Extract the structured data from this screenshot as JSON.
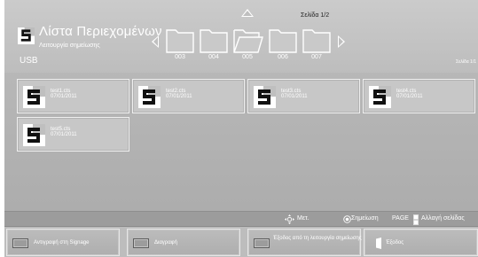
{
  "header": {
    "page_indicator": "Σελίδα 1/2",
    "title": "Λίστα Περιεχομένων",
    "subtitle": "Λειτουργία σημείωσης",
    "device": "USB",
    "page_indicator_right": "Σελίδα 1/1",
    "folders": [
      {
        "label": "003",
        "open": false
      },
      {
        "label": "004",
        "open": false
      },
      {
        "label": "005",
        "open": true
      },
      {
        "label": "006",
        "open": false
      },
      {
        "label": "007",
        "open": false
      }
    ]
  },
  "files": [
    {
      "name": "test1.cts",
      "date": "07/01/2011"
    },
    {
      "name": "test2.cts",
      "date": "07/01/2011"
    },
    {
      "name": "test3.cts",
      "date": "07/01/2011"
    },
    {
      "name": "test4.cts",
      "date": "07/01/2011"
    },
    {
      "name": "test5.cts",
      "date": "07/01/2011"
    }
  ],
  "status_bar": {
    "move_label": "Μετ.",
    "mark_label": "Σημείωση",
    "page_key": "PAGE",
    "page_change_label": "Αλλαγή σελίδας"
  },
  "buttons": {
    "copy_label": "Αντιγραφή στη Signage",
    "delete_label": "Διαγραφή",
    "exit_mark_mode_label": "Έξοδος από τη λειτουργία σημείωσης",
    "exit_label": "Έξοδος"
  },
  "icons": {
    "app_logo": "signage-s-logo-icon",
    "file": "signage-file-icon",
    "folder": "folder-icon",
    "move": "directional-pad-icon",
    "mark": "radio-mark-icon",
    "page": "page-rocker-icon",
    "exit": "exit-door-icon"
  },
  "colors": {
    "text": "#ffffff",
    "logo_dark": "#111111",
    "logo_accent": "#d9d9d9"
  }
}
